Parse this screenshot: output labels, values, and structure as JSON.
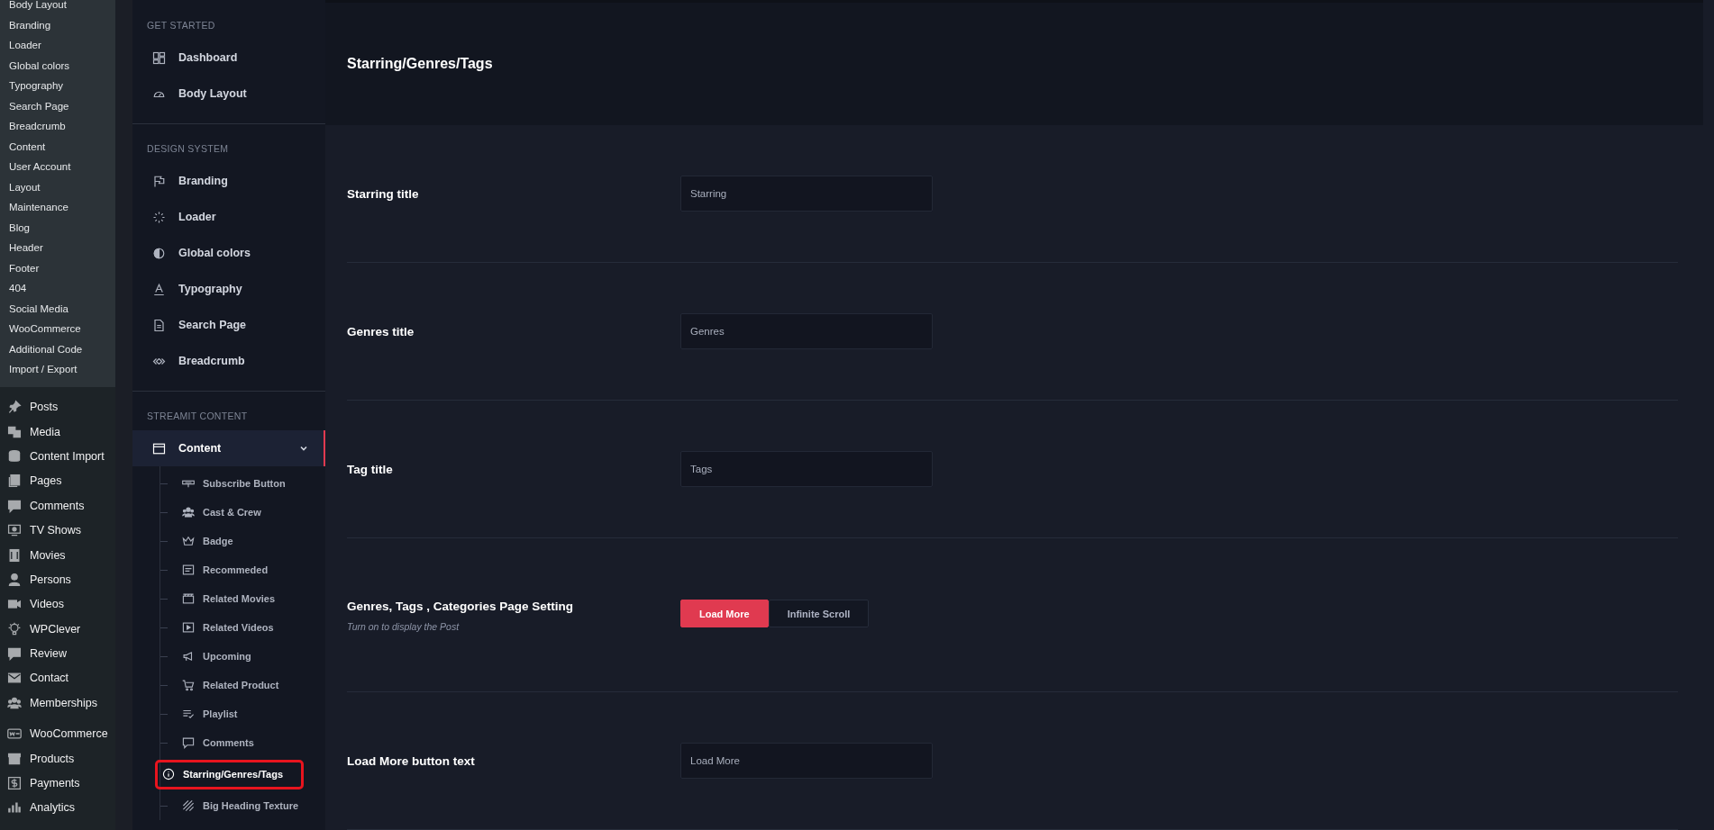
{
  "admin_submenu": [
    "Body Layout",
    "Branding",
    "Loader",
    "Global colors",
    "Typography",
    "Search Page",
    "Breadcrumb",
    "Content",
    "User Account",
    "Layout",
    "Maintenance",
    "Blog",
    "Header",
    "Footer",
    "404",
    "Social Media",
    "WooCommerce",
    "Additional Code",
    "Import / Export"
  ],
  "admin_menu": [
    "Posts",
    "Media",
    "Content Import",
    "Pages",
    "Comments",
    "TV Shows",
    "Movies",
    "Persons",
    "Videos",
    "WPClever",
    "Review",
    "Contact",
    "Memberships"
  ],
  "admin_commerce_menu": [
    "WooCommerce",
    "Products",
    "Payments",
    "Analytics"
  ],
  "options_nav": [
    {
      "title": "GET STARTED",
      "items": [
        {
          "label": "Dashboard",
          "selected": false
        },
        {
          "label": "Body Layout",
          "selected": false
        }
      ]
    },
    {
      "title": "DESIGN SYSTEM",
      "items": [
        {
          "label": "Branding",
          "selected": false
        },
        {
          "label": "Loader",
          "selected": false
        },
        {
          "label": "Global colors",
          "selected": false
        },
        {
          "label": "Typography",
          "selected": false
        },
        {
          "label": "Search Page",
          "selected": false
        },
        {
          "label": "Breadcrumb",
          "selected": false
        }
      ]
    },
    {
      "title": "STREAMIT CONTENT",
      "items": [
        {
          "label": "Content",
          "selected": true,
          "expanded": true,
          "children": [
            {
              "label": "Subscribe Button",
              "selected": false
            },
            {
              "label": "Cast & Crew",
              "selected": false
            },
            {
              "label": "Badge",
              "selected": false
            },
            {
              "label": "Recommeded",
              "selected": false
            },
            {
              "label": "Related Movies",
              "selected": false
            },
            {
              "label": "Related Videos",
              "selected": false
            },
            {
              "label": "Upcoming",
              "selected": false
            },
            {
              "label": "Related Product",
              "selected": false
            },
            {
              "label": "Playlist",
              "selected": false
            },
            {
              "label": "Comments",
              "selected": false
            },
            {
              "label": "Starring/Genres/Tags",
              "selected": true
            },
            {
              "label": "Big Heading Texture",
              "selected": false
            }
          ]
        }
      ]
    }
  ],
  "page": {
    "title": "Starring/Genres/Tags",
    "settings": [
      {
        "kind": "text",
        "label": "Starring title",
        "value": "Starring"
      },
      {
        "kind": "text",
        "label": "Genres title",
        "value": "Genres"
      },
      {
        "kind": "text",
        "label": "Tag title",
        "value": "Tags"
      },
      {
        "kind": "choice",
        "label": "Genres, Tags , Categories Page Setting",
        "description": "Turn on to display the Post",
        "options": [
          {
            "label": "Load More",
            "selected": true
          },
          {
            "label": "Infinite Scroll",
            "selected": false
          }
        ]
      },
      {
        "kind": "text",
        "label": "Load More button text",
        "value": "Load More"
      }
    ]
  }
}
